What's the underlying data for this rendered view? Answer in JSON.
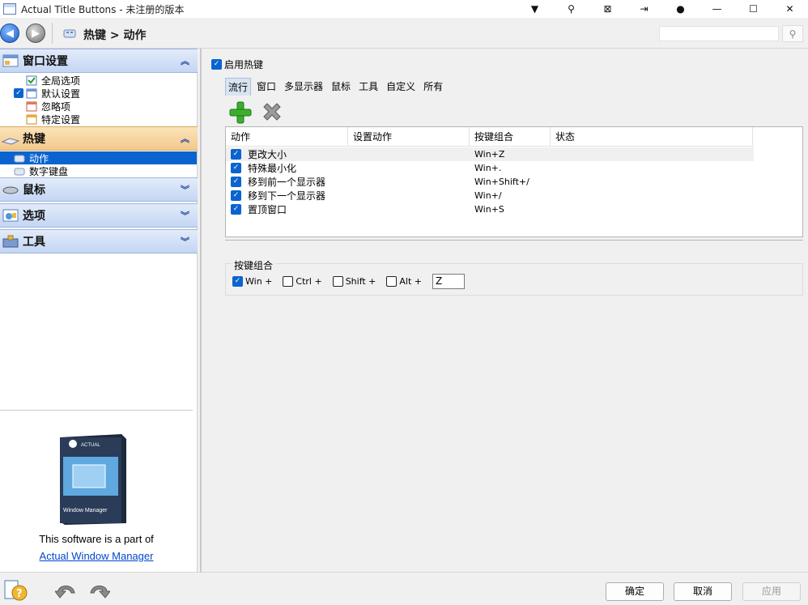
{
  "window": {
    "title": "Actual Title Buttons - 未注册的版本",
    "controls": [
      "▼",
      "⚲",
      "⊠",
      "⇥",
      "●",
      "—",
      "☐",
      "✕"
    ]
  },
  "nav": {
    "breadcrumb": "热键 > 动作",
    "search_placeholder": ""
  },
  "sidebar": {
    "groups": [
      {
        "label": "窗口设置",
        "chevron": "︽",
        "items": [
          {
            "label": "全局选项",
            "checked": false
          },
          {
            "label": "默认设置",
            "checked": true
          },
          {
            "label": "忽略项",
            "checked": false
          },
          {
            "label": "特定设置",
            "checked": false
          }
        ]
      },
      {
        "label": "热键",
        "chevron": "︽",
        "items": [
          {
            "label": "动作",
            "selected": true
          },
          {
            "label": "数字键盘"
          }
        ]
      },
      {
        "label": "鼠标",
        "chevron": "︾"
      },
      {
        "label": "选项",
        "chevron": "︾"
      },
      {
        "label": "工具",
        "chevron": "︾"
      }
    ],
    "promo_text": "This software is a part of",
    "promo_link": "Actual Window Manager",
    "boxshot_title": "Window Manager",
    "boxshot_brand": "ACTUAL"
  },
  "main": {
    "enable_label": "启用热键",
    "enable_checked": true,
    "tabs": [
      "流行",
      "窗口",
      "多显示器",
      "鼠标",
      "工具",
      "自定义",
      "所有"
    ],
    "active_tab": 0,
    "columns": [
      "动作",
      "设置动作",
      "按键组合",
      "状态"
    ],
    "rows": [
      {
        "action": "更改大小",
        "keys": "Win+Z",
        "checked": true
      },
      {
        "action": "特殊最小化",
        "keys": "Win+.",
        "checked": true
      },
      {
        "action": "移到前一个显示器",
        "keys": "Win+Shift+/",
        "checked": true
      },
      {
        "action": "移到下一个显示器",
        "keys": "Win+/",
        "checked": true
      },
      {
        "action": "置顶窗口",
        "keys": "Win+S",
        "checked": true
      }
    ],
    "combo": {
      "legend": "按键组合",
      "win_label": "Win +",
      "win_checked": true,
      "ctrl_label": "Ctrl +",
      "ctrl_checked": false,
      "shift_label": "Shift +",
      "shift_checked": false,
      "alt_label": "Alt +",
      "alt_checked": false,
      "key_value": "Z"
    }
  },
  "footer": {
    "ok": "确定",
    "cancel": "取消",
    "apply": "应用"
  },
  "colors": {
    "selection": "#0a64d0",
    "group_header": "#c4d6f3",
    "group_header_active": "#f2c98c",
    "link": "#0047ce"
  }
}
